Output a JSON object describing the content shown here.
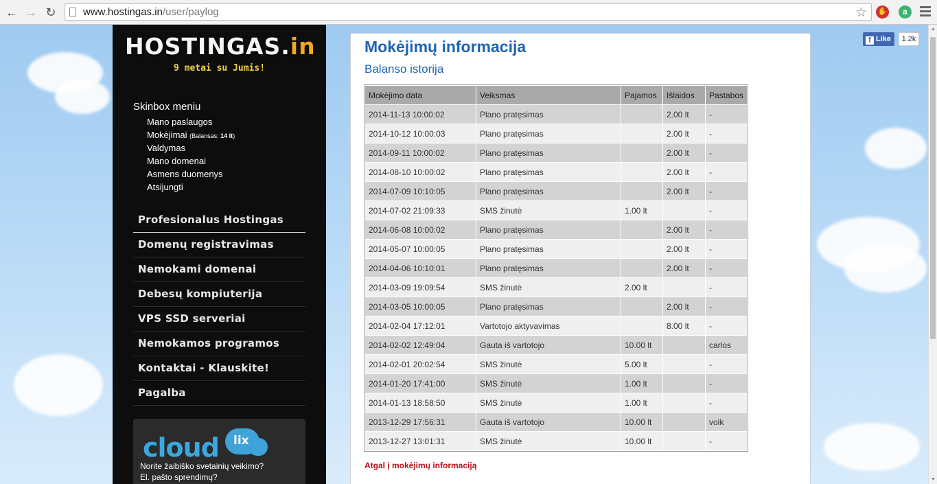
{
  "browser": {
    "url_host": "www.hostingas.in",
    "url_path": "/user/paylog"
  },
  "sidebar": {
    "logo_main": "HOSTINGAS.",
    "logo_tld": "in",
    "tagline": "9 metai su Jumis!",
    "skinbox_title": "Skinbox meniu",
    "skinbox_items": [
      "Mano paslaugos",
      "Mokėjimai",
      "Valdymas",
      "Mano domenai",
      "Asmens duomenys",
      "Atsijungti"
    ],
    "balance_label": "(Balansas: ",
    "balance_value": "14 lt",
    "balance_close": ")",
    "nav_items": [
      "Profesionalus Hostingas",
      "Domenų registravimas",
      "Nemokami domenai",
      "Debesų kompiuterija",
      "VPS SSD serveriai",
      "Nemokamos programos",
      "Kontaktai - Klauskite!",
      "Pagalba"
    ],
    "promo": {
      "brand": "cloud",
      "brand_suffix": "lix",
      "line1": "Norite žaibiško svetainių veikimo?",
      "line2": "El. pašto sprendimų?"
    }
  },
  "content": {
    "title": "Mokėjimų informacija",
    "subtitle": "Balanso istorija",
    "table": {
      "headers": [
        "Mokėjimo data",
        "Veiksmas",
        "Pajamos",
        "Išlaidos",
        "Pastabos"
      ],
      "rows": [
        [
          "2014-11-13 10:00:02",
          "Plano pratęsimas",
          "",
          "2.00 lt",
          "-"
        ],
        [
          "2014-10-12 10:00:03",
          "Plano pratęsimas",
          "",
          "2.00 lt",
          "-"
        ],
        [
          "2014-09-11 10:00:02",
          "Plano pratęsimas",
          "",
          "2.00 lt",
          "-"
        ],
        [
          "2014-08-10 10:00:02",
          "Plano pratęsimas",
          "",
          "2.00 lt",
          "-"
        ],
        [
          "2014-07-09 10:10:05",
          "Plano pratęsimas",
          "",
          "2.00 lt",
          "-"
        ],
        [
          "2014-07-02 21:09:33",
          "SMS žinutė",
          "1.00 lt",
          "",
          "-"
        ],
        [
          "2014-06-08 10:00:02",
          "Plano pratęsimas",
          "",
          "2.00 lt",
          "-"
        ],
        [
          "2014-05-07 10:00:05",
          "Plano pratęsimas",
          "",
          "2.00 lt",
          "-"
        ],
        [
          "2014-04-06 10:10:01",
          "Plano pratęsimas",
          "",
          "2.00 lt",
          "-"
        ],
        [
          "2014-03-09 19:09:54",
          "SMS žinutė",
          "2.00 lt",
          "",
          "-"
        ],
        [
          "2014-03-05 10:00:05",
          "Plano pratęsimas",
          "",
          "2.00 lt",
          "-"
        ],
        [
          "2014-02-04 17:12:01",
          "Vartotojo aktyvavimas",
          "",
          "8.00 lt",
          "-"
        ],
        [
          "2014-02-02 12:49:04",
          "Gauta iš vartotojo",
          "10.00 lt",
          "",
          "carlos"
        ],
        [
          "2014-02-01 20:02:54",
          "SMS žinutė",
          "5.00 lt",
          "",
          "-"
        ],
        [
          "2014-01-20 17:41:00",
          "SMS žinutė",
          "1.00 lt",
          "",
          "-"
        ],
        [
          "2014-01-13 18:58:50",
          "SMS žinutė",
          "1.00 lt",
          "",
          "-"
        ],
        [
          "2013-12-29 17:56:31",
          "Gauta iš vartotojo",
          "10.00 lt",
          "",
          "volk"
        ],
        [
          "2013-12-27 13:01:31",
          "SMS žinutė",
          "10.00 lt",
          "",
          "-"
        ]
      ]
    },
    "back_link": "Atgal į mokėjimų informaciją"
  },
  "facebook": {
    "like_label": "Like",
    "count": "1.2k"
  }
}
